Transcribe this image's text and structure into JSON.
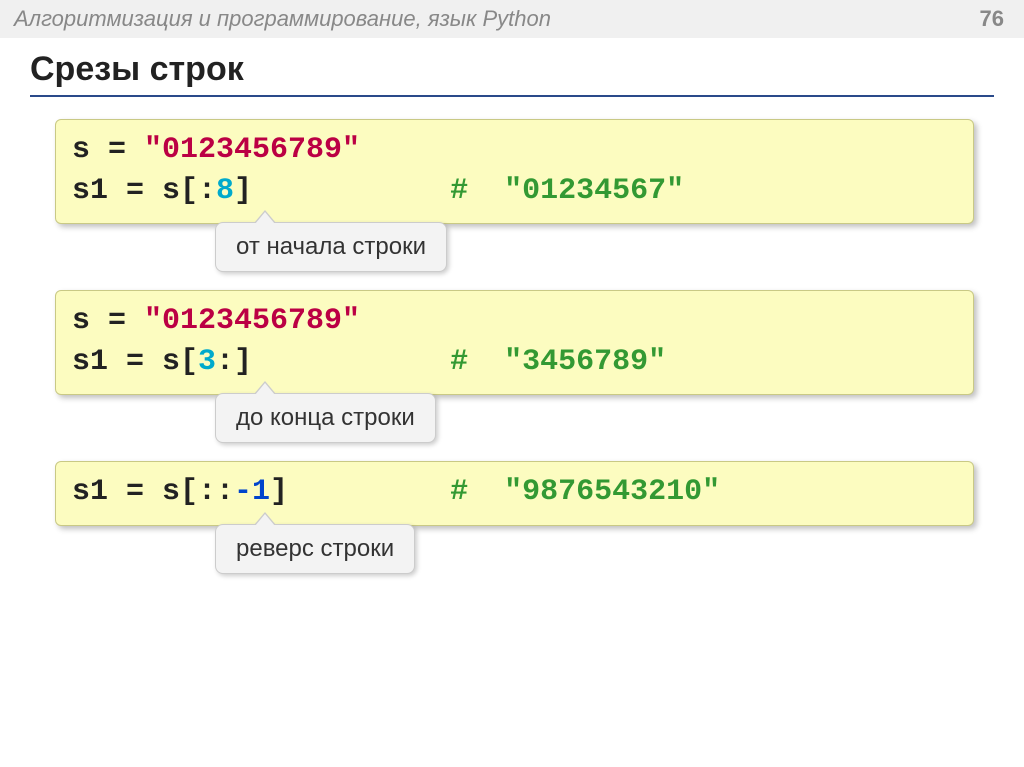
{
  "header": {
    "breadcrumb": "Алгоритмизация и программирование, язык Python",
    "page_number": "76"
  },
  "title": "Срезы строк",
  "block1": {
    "line1_pre": "s = ",
    "line1_str": "\"0123456789\"",
    "line2_pre": "s1 = s[:",
    "line2_num": "8",
    "line2_post": "]",
    "line2_comment": "#  \"01234567\"",
    "callout": "от начала строки"
  },
  "block2": {
    "line1_pre": "s = ",
    "line1_str": "\"0123456789\"",
    "line2_pre": "s1 = s[",
    "line2_num": "3",
    "line2_post": ":]",
    "line2_comment": "#  \"3456789\"",
    "callout": "до конца строки"
  },
  "block3": {
    "line1_pre": "s1 = s[::",
    "line1_num": "-1",
    "line1_post": "]",
    "line1_comment": "#  \"9876543210\"",
    "callout": "реверс строки"
  }
}
